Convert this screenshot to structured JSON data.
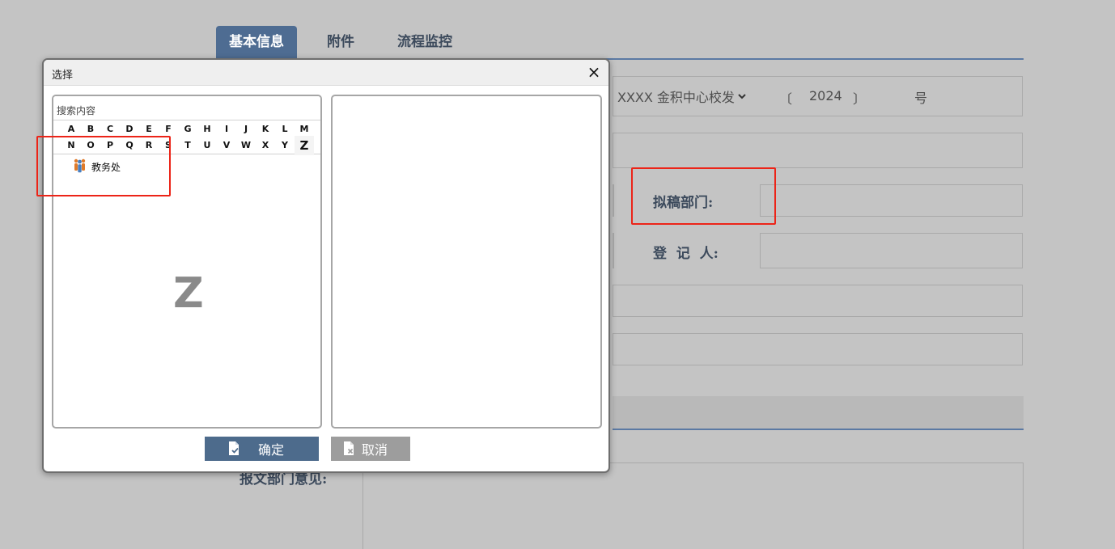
{
  "tabs": [
    {
      "label": "基本信息",
      "active": true
    },
    {
      "label": "附件",
      "active": false
    },
    {
      "label": "流程监控",
      "active": false
    }
  ],
  "form": {
    "doc_prefix": "XXXX 金积中心校发",
    "year_open": "〔",
    "year": "2024",
    "year_close": "〕",
    "number_suffix": "号",
    "drafting_dept_label": "拟稿部门:",
    "registrar_label": "登  记  人:",
    "dept_opinion_label": "报文部门意见:"
  },
  "dialog": {
    "title": "选择",
    "close_glyph": "×",
    "search_placeholder": "搜索内容",
    "letters": [
      "A",
      "B",
      "C",
      "D",
      "E",
      "F",
      "G",
      "H",
      "I",
      "J",
      "K",
      "L",
      "M",
      "N",
      "O",
      "P",
      "Q",
      "R",
      "S",
      "T",
      "U",
      "V",
      "W",
      "X",
      "Y",
      "Z"
    ],
    "active_letter": "Z",
    "tree_items": [
      {
        "label": "教务处",
        "icon": "people-group-icon"
      }
    ],
    "watermark_letter": "Z",
    "confirm_label": "确定",
    "cancel_label": "取消"
  },
  "colors": {
    "accent": "#4e6c92",
    "confirm_button": "#4d6b8c",
    "cancel_button": "#9d9d9d",
    "annotation": "#ec2418",
    "page_overlay": "#c4c4c4"
  }
}
